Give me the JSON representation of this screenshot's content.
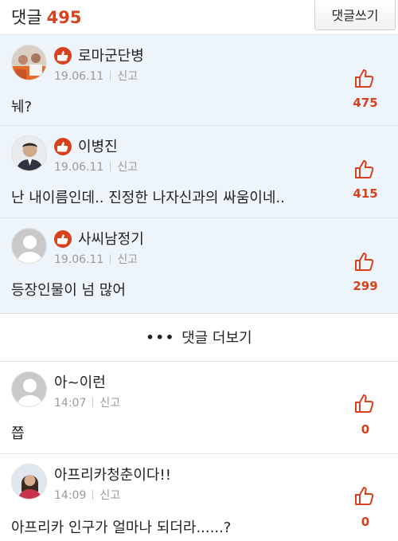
{
  "header": {
    "title": "댓글",
    "count": "495",
    "write_button": "댓글쓰기"
  },
  "best_comments": [
    {
      "nickname": "로마군단병",
      "date": "19.06.11",
      "report": "신고",
      "text": "눼?",
      "likes": "475",
      "avatar": "photo-crowd"
    },
    {
      "nickname": "이병진",
      "date": "19.06.11",
      "report": "신고",
      "text": "난 내이름인데.. 진정한 나자신과의 싸움이네..",
      "likes": "415",
      "avatar": "photo-man"
    },
    {
      "nickname": "사씨남정기",
      "date": "19.06.11",
      "report": "신고",
      "text": "등장인물이 넘 많어",
      "likes": "299",
      "avatar": "default"
    }
  ],
  "more": {
    "dots": "•••",
    "label": "댓글 더보기"
  },
  "comments": [
    {
      "nickname": "아~이런",
      "time": "14:07",
      "report": "신고",
      "text": "쯥",
      "likes": "0",
      "avatar": "default"
    },
    {
      "nickname": "아프리카청춘이다!!",
      "time": "14:09",
      "report": "신고",
      "text": "아프리카 인구가 얼마나 되더라......?",
      "likes": "0",
      "avatar": "photo-woman"
    }
  ],
  "colors": {
    "accent": "#d7411e",
    "best_background": "#eef5fa",
    "meta_text": "#9a9a9a"
  }
}
